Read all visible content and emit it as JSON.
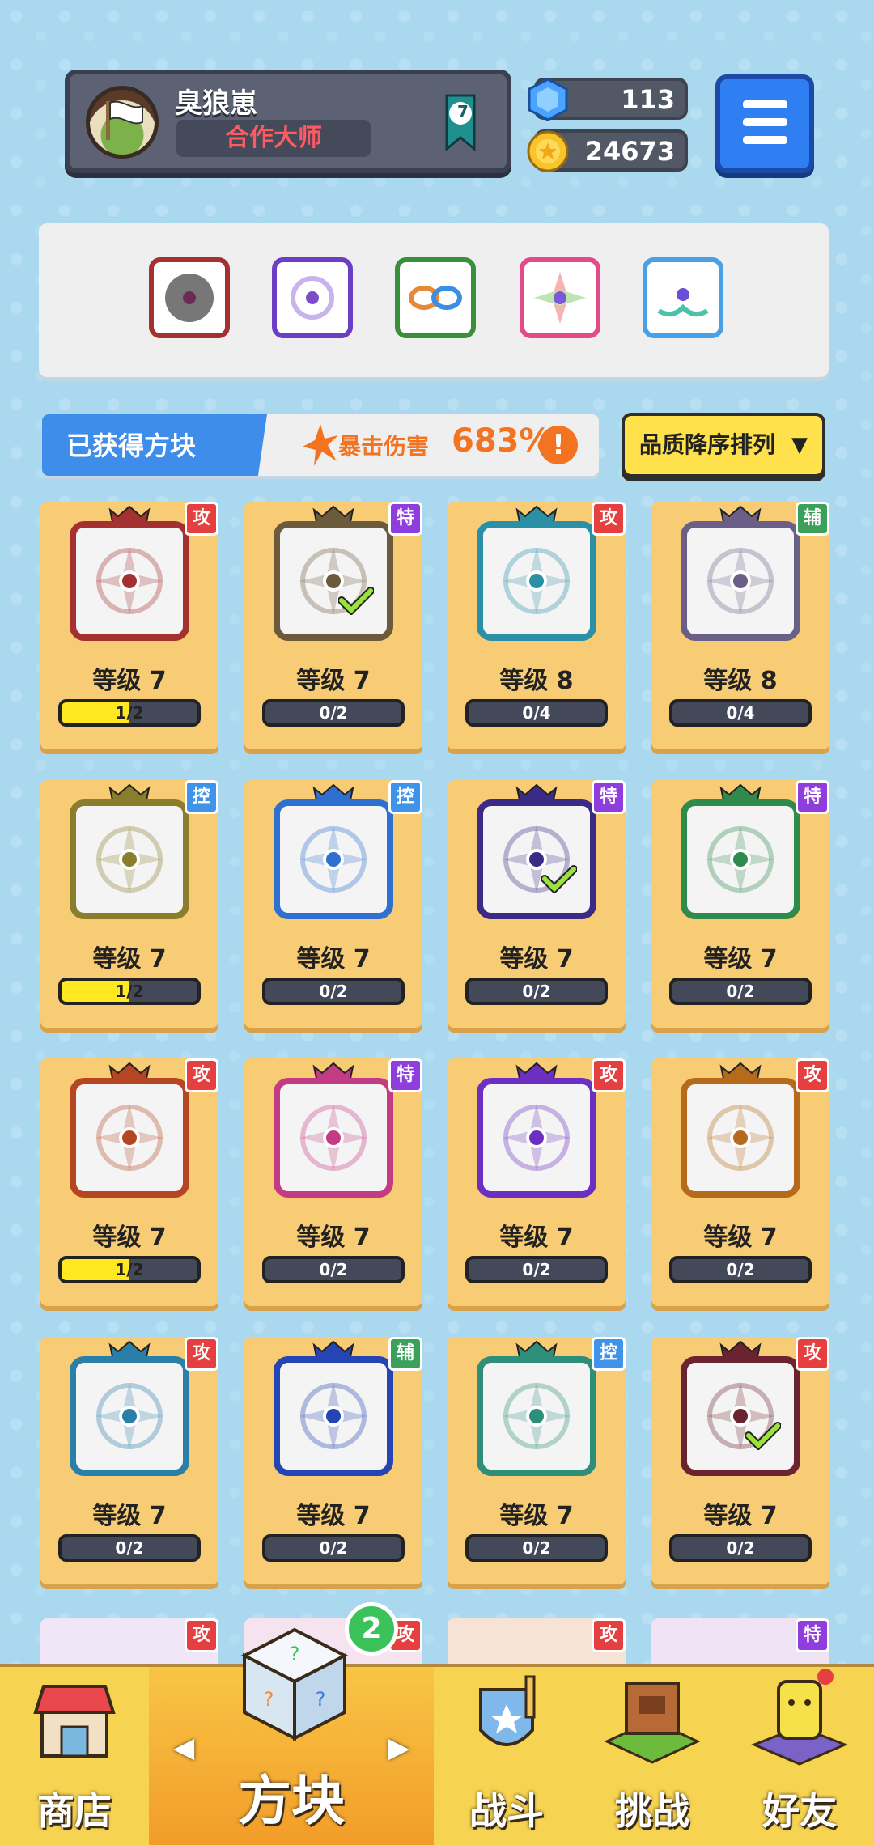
{
  "header": {
    "player_name": "臭狼崽",
    "player_title": "合作大师",
    "rank_level": "7",
    "gems": "113",
    "coins": "24673"
  },
  "obtained": {
    "label": "已获得方块",
    "crit_label": "暴击伤害",
    "crit_value": "683%",
    "crit_info": "!"
  },
  "sort_label": "品质降序排列",
  "sort_arrow": "▼",
  "level_prefix": "等级",
  "cards": [
    {
      "tag": "攻",
      "level": "等级 7",
      "progress": "1/2",
      "fill": 0.5,
      "color": "#a53030",
      "check": false
    },
    {
      "tag": "特",
      "level": "等级 7",
      "progress": "0/2",
      "fill": 0,
      "color": "#6b5a3b",
      "check": true
    },
    {
      "tag": "攻",
      "level": "等级 8",
      "progress": "0/4",
      "fill": 0,
      "color": "#2b8fa6",
      "check": false
    },
    {
      "tag": "辅",
      "level": "等级 8",
      "progress": "0/4",
      "fill": 0,
      "color": "#6a5f86",
      "check": false
    },
    {
      "tag": "控",
      "level": "等级 7",
      "progress": "1/2",
      "fill": 0.5,
      "color": "#8a7d2c",
      "check": false
    },
    {
      "tag": "控",
      "level": "等级 7",
      "progress": "0/2",
      "fill": 0,
      "color": "#2e6fd0",
      "check": false
    },
    {
      "tag": "特",
      "level": "等级 7",
      "progress": "0/2",
      "fill": 0,
      "color": "#3b2a86",
      "check": true
    },
    {
      "tag": "特",
      "level": "等级 7",
      "progress": "0/2",
      "fill": 0,
      "color": "#2f8a4c",
      "check": false
    },
    {
      "tag": "攻",
      "level": "等级 7",
      "progress": "1/2",
      "fill": 0.5,
      "color": "#b54623",
      "check": false
    },
    {
      "tag": "特",
      "level": "等级 7",
      "progress": "0/2",
      "fill": 0,
      "color": "#c33b84",
      "check": false
    },
    {
      "tag": "攻",
      "level": "等级 7",
      "progress": "0/2",
      "fill": 0,
      "color": "#6d2fc1",
      "check": false
    },
    {
      "tag": "攻",
      "level": "等级 7",
      "progress": "0/2",
      "fill": 0,
      "color": "#b56a1c",
      "check": false
    },
    {
      "tag": "攻",
      "level": "等级 7",
      "progress": "0/2",
      "fill": 0,
      "color": "#2a7fa8",
      "check": false
    },
    {
      "tag": "辅",
      "level": "等级 7",
      "progress": "0/2",
      "fill": 0,
      "color": "#2445b3",
      "check": false
    },
    {
      "tag": "控",
      "level": "等级 7",
      "progress": "0/2",
      "fill": 0,
      "color": "#2e8e7a",
      "check": false
    },
    {
      "tag": "攻",
      "level": "等级 7",
      "progress": "0/2",
      "fill": 0,
      "color": "#6b2330",
      "check": true
    }
  ],
  "partial_tags": [
    "攻",
    "攻",
    "攻",
    "特"
  ],
  "nav": {
    "shop": "商店",
    "blocks": "方块",
    "battle": "战斗",
    "challenge": "挑战",
    "friends": "好友",
    "blocks_badge": "2",
    "prev": "◀",
    "next": "▶"
  },
  "colors": {
    "attack": "#e5403f",
    "special": "#8f3ddc",
    "support": "#3aa05a",
    "control": "#3f93e8",
    "card_bg": "#f8cc74",
    "progress_fill": "#ffe81f"
  },
  "icons": {
    "gem": "blue-gem-icon",
    "coin": "gold-coin-icon",
    "menu": "hamburger-menu-icon",
    "rank": "rank-ribbon-icon"
  }
}
